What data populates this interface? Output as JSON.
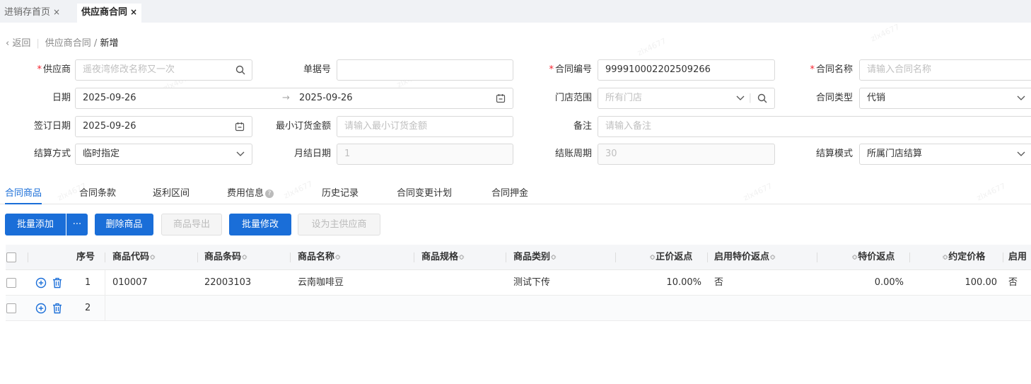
{
  "tabs": [
    {
      "label": "进销存首页",
      "close": "×"
    },
    {
      "label": "供应商合同",
      "close": "×"
    }
  ],
  "breadcrumb": {
    "back": "返回",
    "parent": "供应商合同",
    "separator": "/",
    "current": "新增"
  },
  "form": {
    "supplier": {
      "label": "供应商",
      "value": "遥夜湾修改名称又一次"
    },
    "doc_no": {
      "label": "单据号",
      "value": ""
    },
    "contract_no": {
      "label": "合同编号",
      "value": "999910002202509266"
    },
    "contract_name": {
      "label": "合同名称",
      "placeholder": "请输入合同名称"
    },
    "date": {
      "label": "日期",
      "start": "2025-09-26",
      "arrow": "→",
      "end": "2025-09-26"
    },
    "store_range": {
      "label": "门店范围",
      "placeholder": "所有门店"
    },
    "contract_type": {
      "label": "合同类型",
      "value": "代销"
    },
    "sign_date": {
      "label": "签订日期",
      "value": "2025-09-26"
    },
    "min_order": {
      "label": "最小订货金额",
      "placeholder": "请输入最小订货金额"
    },
    "remark": {
      "label": "备注",
      "placeholder": "请输入备注"
    },
    "settle_method": {
      "label": "结算方式",
      "value": "临时指定"
    },
    "monthly_day": {
      "label": "月结日期",
      "value": "1"
    },
    "billing_cycle": {
      "label": "结账周期",
      "value": "30"
    },
    "settle_mode": {
      "label": "结算模式",
      "value": "所属门店结算"
    }
  },
  "panel_tabs": [
    "合同商品",
    "合同条款",
    "返利区间",
    "费用信息",
    "历史记录",
    "合同变更计划",
    "合同押金"
  ],
  "toolbar": {
    "batch_add": "批量添加",
    "more": "···",
    "delete": "删除商品",
    "export": "商品导出",
    "batch_edit": "批量修改",
    "set_main": "设为主供应商"
  },
  "table": {
    "headers": {
      "seq": "序号",
      "code": "商品代码",
      "barcode": "商品条码",
      "name": "商品名称",
      "spec": "商品规格",
      "category": "商品类别",
      "normal_rebate": "正价返点",
      "enable_special": "启用特价返点",
      "special_rebate": "特价返点",
      "agreed_price": "约定价格",
      "enable_more": "启用"
    },
    "sort_glyph": "≎",
    "rows": [
      {
        "seq": "1",
        "code": "010007",
        "barcode": "22003103",
        "name": "云南咖啡豆",
        "spec": "",
        "category": "测试下传",
        "normal_rebate": "10.00%",
        "enable_special": "否",
        "special_rebate": "0.00%",
        "agreed_price": "100.00",
        "enable_more": "否"
      },
      {
        "seq": "2",
        "code": "",
        "barcode": "",
        "name": "",
        "spec": "",
        "category": "",
        "normal_rebate": "",
        "enable_special": "",
        "special_rebate": "",
        "agreed_price": "",
        "enable_more": ""
      }
    ]
  },
  "watermark": "zlx4677",
  "colors": {
    "primary": "#1a6ed8",
    "required": "#f5222d"
  }
}
